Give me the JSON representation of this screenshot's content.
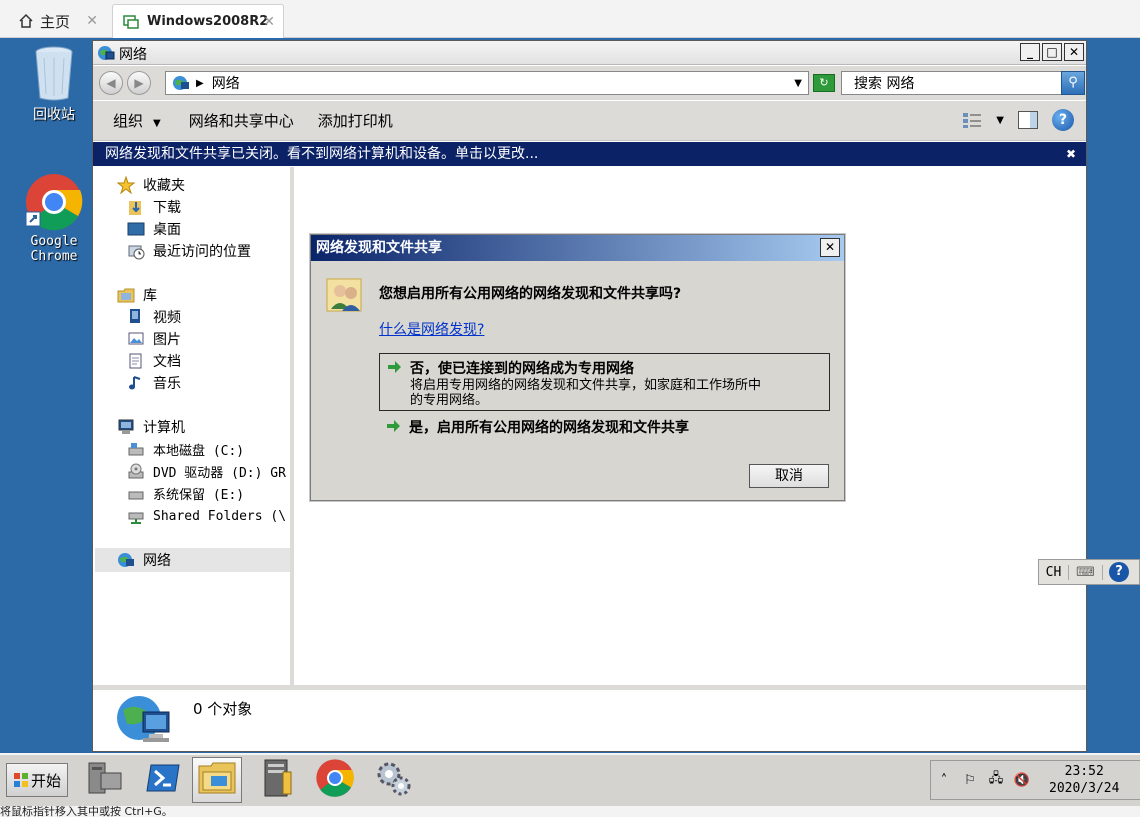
{
  "host": {
    "tabs": [
      {
        "label": "主页",
        "icon": "home-icon"
      },
      {
        "label": "Windows2008R2",
        "icon": "vm-icon"
      }
    ],
    "close_glyph": "✕",
    "status": "将鼠标指针移入其中或按 Ctrl+G。"
  },
  "desktop": {
    "icons": [
      {
        "label": "回收站",
        "icon": "recycle-bin-icon"
      },
      {
        "label": "Google Chrome",
        "line1": "Google",
        "line2": "Chrome",
        "icon": "chrome-icon"
      }
    ]
  },
  "explorer": {
    "title": "网络",
    "address": "网络",
    "search_placeholder": "搜索 网络",
    "commands": {
      "organize": "组织",
      "network_center": "网络和共享中心",
      "add_printer": "添加打印机"
    },
    "infobar": "网络发现和文件共享已关闭。看不到网络计算机和设备。单击以更改...",
    "nav": {
      "favorites": "收藏夹",
      "favorites_items": [
        "下载",
        "桌面",
        "最近访问的位置"
      ],
      "libraries": "库",
      "library_items": [
        "视频",
        "图片",
        "文档",
        "音乐"
      ],
      "computer": "计算机",
      "computer_items": [
        "本地磁盘 (C:)",
        "DVD 驱动器 (D:) GR",
        "系统保留 (E:)",
        "Shared Folders (\\"
      ],
      "network": "网络"
    },
    "status_count": "0 个对象"
  },
  "dialog": {
    "title": "网络发现和文件共享",
    "question": "您想启用所有公用网络的网络发现和文件共享吗?",
    "link": "什么是网络发现?",
    "option_no_heading": "否，使已连接到的网络成为专用网络",
    "option_no_desc1": "将启用专用网络的网络发现和文件共享，如家庭和工作场所中",
    "option_no_desc2": "的专用网络。",
    "option_yes_heading": "是，启用所有公用网络的网络发现和文件共享",
    "cancel": "取消"
  },
  "langbar": {
    "lang": "CH"
  },
  "taskbar": {
    "start": "开始",
    "time": "23:52",
    "date": "2020/3/24"
  }
}
